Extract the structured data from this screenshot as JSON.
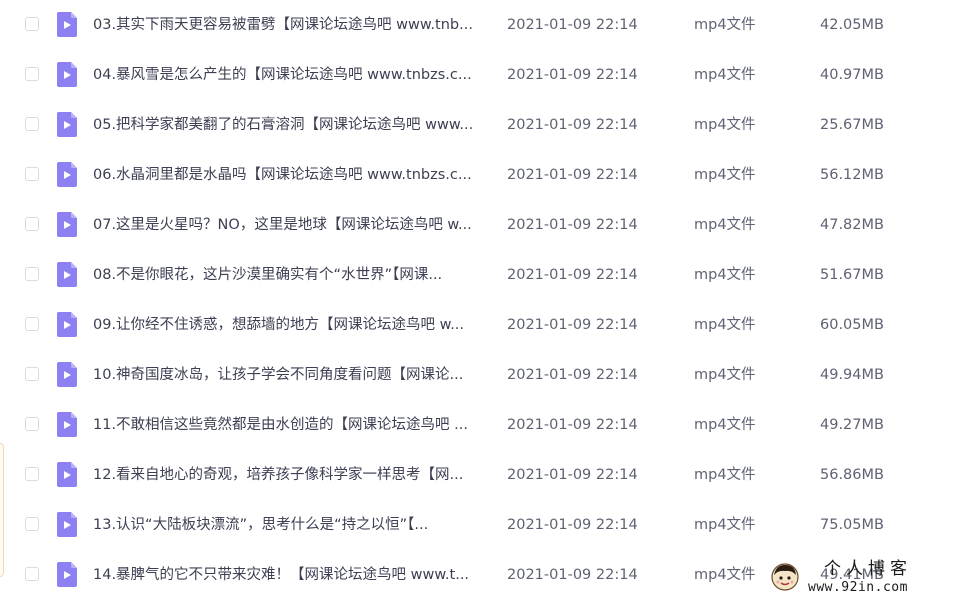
{
  "file_list": {
    "rows": [
      {
        "name": "03.其实下雨天更容易被雷劈【网课论坛途鸟吧 www.tnb...",
        "date": "2021-01-09 22:14",
        "type": "mp4文件",
        "size": "42.05MB"
      },
      {
        "name": "04.暴风雪是怎么产生的【网课论坛途鸟吧 www.tnbzs.c...",
        "date": "2021-01-09 22:14",
        "type": "mp4文件",
        "size": "40.97MB"
      },
      {
        "name": "05.把科学家都美翻了的石膏溶洞【网课论坛途鸟吧 www...",
        "date": "2021-01-09 22:14",
        "type": "mp4文件",
        "size": "25.67MB"
      },
      {
        "name": "06.水晶洞里都是水晶吗【网课论坛途鸟吧 www.tnbzs.c...",
        "date": "2021-01-09 22:14",
        "type": "mp4文件",
        "size": "56.12MB"
      },
      {
        "name": "07.这里是火星吗？NO，这里是地球【网课论坛途鸟吧 w...",
        "date": "2021-01-09 22:14",
        "type": "mp4文件",
        "size": "47.82MB"
      },
      {
        "name": "08.不是你眼花，这片沙漠里确实有个“水世界”【网课...",
        "date": "2021-01-09 22:14",
        "type": "mp4文件",
        "size": "51.67MB"
      },
      {
        "name": "09.让你经不住诱惑，想舔墙的地方【网课论坛途鸟吧 w...",
        "date": "2021-01-09 22:14",
        "type": "mp4文件",
        "size": "60.05MB"
      },
      {
        "name": "10.神奇国度冰岛，让孩子学会不同角度看问题【网课论...",
        "date": "2021-01-09 22:14",
        "type": "mp4文件",
        "size": "49.94MB"
      },
      {
        "name": "11.不敢相信这些竟然都是由水创造的【网课论坛途鸟吧 ...",
        "date": "2021-01-09 22:14",
        "type": "mp4文件",
        "size": "49.27MB"
      },
      {
        "name": "12.看来自地心的奇观，培养孩子像科学家一样思考【网...",
        "date": "2021-01-09 22:14",
        "type": "mp4文件",
        "size": "56.86MB"
      },
      {
        "name": "13.认识“大陆板块漂流”，思考什么是“持之以恒”【...",
        "date": "2021-01-09 22:14",
        "type": "mp4文件",
        "size": "75.05MB"
      },
      {
        "name": "14.暴脾气的它不只带来灾难！【网课论坛途鸟吧 www.t...",
        "date": "2021-01-09 22:14",
        "type": "mp4文件",
        "size": "49.41MB"
      }
    ]
  },
  "watermark": {
    "title": "个人博客",
    "url": "www.92in.com"
  },
  "colors": {
    "icon_purple": "#8c80f2",
    "icon_fold": "#b8b0f8",
    "text_primary": "#3c3f52",
    "text_secondary": "#5f6273"
  },
  "icons": {
    "file": "video-file-icon",
    "checkbox": "checkbox-icon",
    "watermark": "avatar-icon"
  }
}
